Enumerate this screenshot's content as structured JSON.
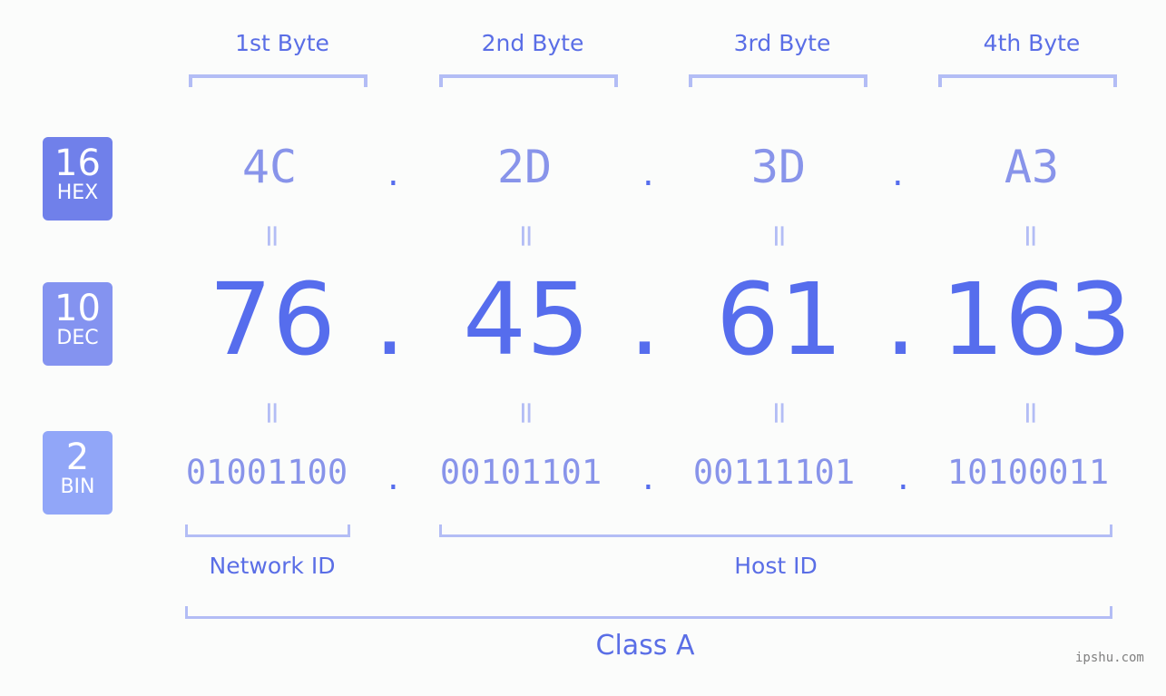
{
  "byte_headers": [
    "1st Byte",
    "2nd Byte",
    "3rd Byte",
    "4th Byte"
  ],
  "badges": {
    "hex": {
      "num": "16",
      "label": "HEX",
      "color": "#7080ea"
    },
    "dec": {
      "num": "10",
      "label": "DEC",
      "color": "#8493f0"
    },
    "bin": {
      "num": "2",
      "label": "BIN",
      "color": "#91a6f8"
    }
  },
  "hex_values": [
    "4C",
    "2D",
    "3D",
    "A3"
  ],
  "dec_values": [
    "76",
    "45",
    "61",
    "163"
  ],
  "bin_values": [
    "01001100",
    "00101101",
    "00111101",
    "10100011"
  ],
  "separator": ".",
  "equals": "=",
  "network_id_label": "Network ID",
  "host_id_label": "Host ID",
  "class_label": "Class A",
  "watermark": "ipshu.com",
  "colors": {
    "primary": "#566ded",
    "light": "#8894ea",
    "bracket": "#b3bdf5"
  }
}
